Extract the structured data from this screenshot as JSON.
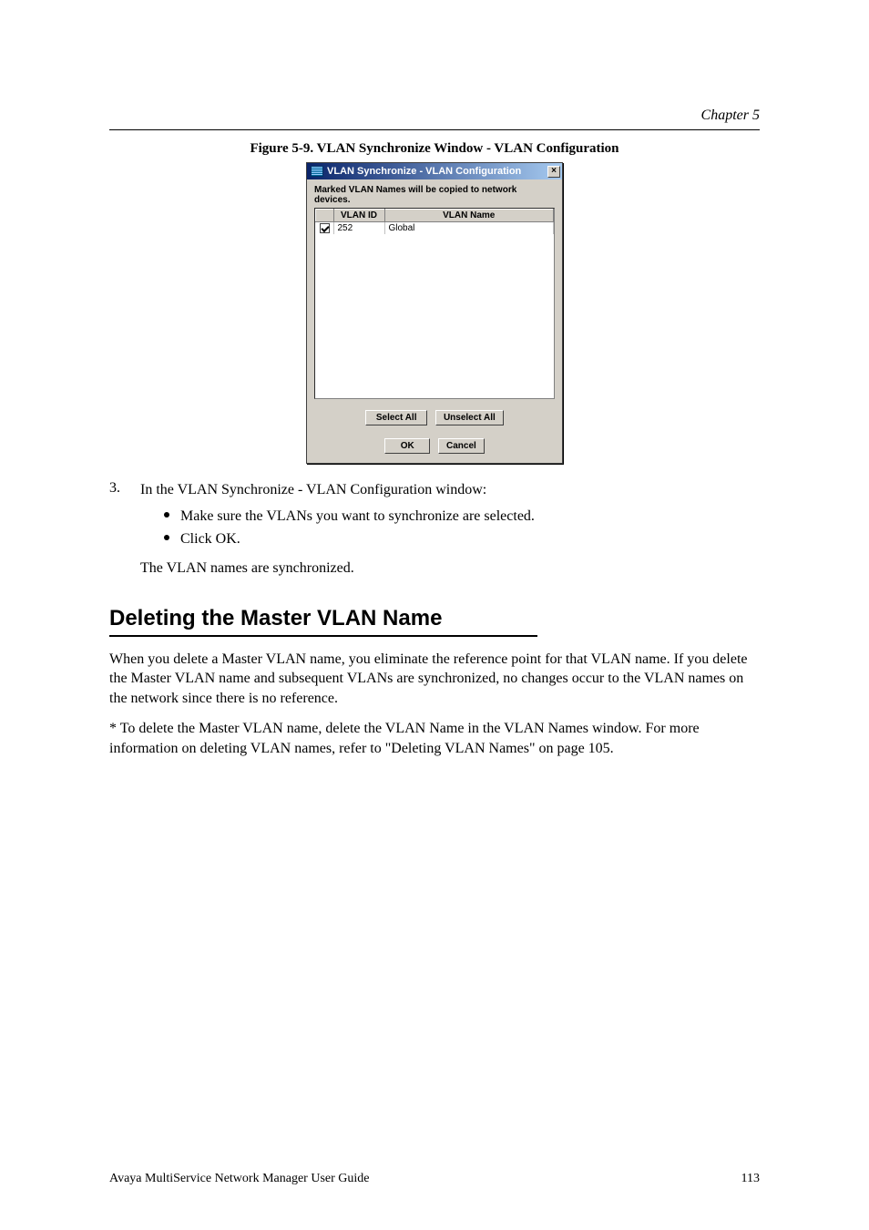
{
  "header": {
    "right_text": "Chapter 5"
  },
  "figure": {
    "caption": "Figure 5-9. VLAN Synchronize Window - VLAN Configuration",
    "dialog": {
      "title": "VLAN Synchronize - VLAN Configuration",
      "close_glyph": "×",
      "instruction": "Marked VLAN Names will be copied to network devices.",
      "columns": {
        "chk": "",
        "id": "VLAN ID",
        "name": "VLAN Name"
      },
      "rows": [
        {
          "checked": true,
          "id": "252",
          "name": "Global"
        }
      ],
      "buttons": {
        "select_all": "Select All",
        "unselect_all": "Unselect All",
        "ok": "OK",
        "cancel": "Cancel"
      }
    }
  },
  "step": {
    "number": "3.",
    "text": "In the VLAN Synchronize - VLAN Configuration window:"
  },
  "bullets": [
    "Make sure the VLANs you want to synchronize are selected.",
    "Click OK."
  ],
  "after_bullets": "The VLAN names are synchronized.",
  "section": {
    "title": "Deleting the Master VLAN Name",
    "p1": "When you delete a Master VLAN name, you eliminate the reference point for that VLAN name. If you delete the Master VLAN name and subsequent VLANs are synchronized, no changes occur to the VLAN names on the network since there is no reference.",
    "p2": "* To delete the Master VLAN name, delete the VLAN Name in the VLAN Names window. For more information on deleting VLAN names, refer to \"Deleting VLAN Names\" on page 105."
  },
  "footer": {
    "left": "Avaya MultiService Network Manager User Guide",
    "right": "113"
  }
}
